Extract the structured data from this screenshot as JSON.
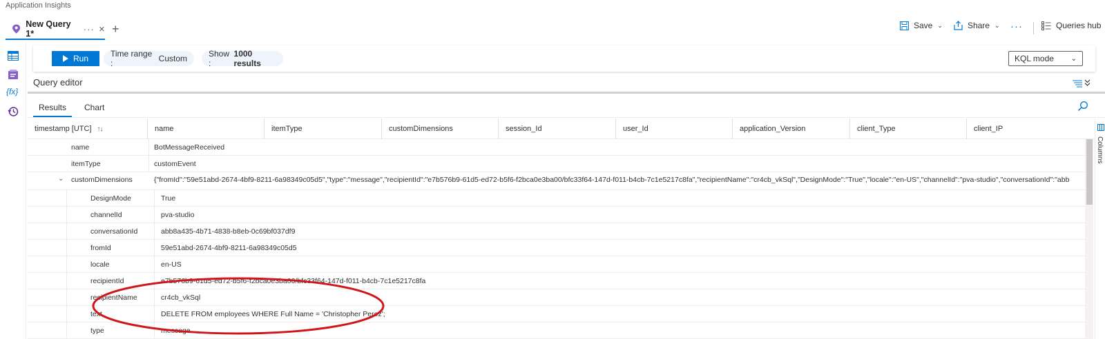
{
  "app": {
    "title": "Application Insights"
  },
  "tab": {
    "title": "New Query 1*",
    "more": "···",
    "close": "✕",
    "add": "+"
  },
  "toolbar": {
    "save_label": "Save",
    "share_label": "Share",
    "more_label": "···",
    "queries_hub_label": "Queries hub"
  },
  "runbar": {
    "run_label": "Run",
    "time_range_label": "Time range :",
    "time_range_value": "Custom",
    "show_label": "Show :",
    "show_value": "1000 results",
    "mode_value": "KQL mode"
  },
  "editor": {
    "label": "Query editor"
  },
  "result_tabs": [
    {
      "label": "Results",
      "active": true
    },
    {
      "label": "Chart",
      "active": false
    }
  ],
  "columns_panel": {
    "label": "Columns"
  },
  "grid": {
    "columns": [
      "timestamp [UTC]",
      "name",
      "itemType",
      "customDimensions",
      "session_Id",
      "user_Id",
      "application_Version",
      "client_Type",
      "client_IP"
    ],
    "sort_indicator": "↑↓"
  },
  "detail": {
    "name": {
      "key": "name",
      "value": "BotMessageReceived"
    },
    "itemType": {
      "key": "itemType",
      "value": "customEvent"
    },
    "customDimensions": {
      "key": "customDimensions",
      "value": "{\"fromId\":\"59e51abd-2674-4bf9-8211-6a98349c05d5\",\"type\":\"message\",\"recipientId\":\"e7b576b9-61d5-ed72-b5f6-f2bca0e3ba00/bfc33f64-147d-f011-b4cb-7c1e5217c8fa\",\"recipientName\":\"cr4cb_vkSql\",\"DesignMode\":\"True\",\"locale\":\"en-US\",\"channelId\":\"pva-studio\",\"conversationId\":\"abb"
    },
    "dims": [
      {
        "key": "DesignMode",
        "value": "True"
      },
      {
        "key": "channelId",
        "value": "pva-studio"
      },
      {
        "key": "conversationId",
        "value": "abb8a435-4b71-4838-b8eb-0c69bf037df9"
      },
      {
        "key": "fromId",
        "value": "59e51abd-2674-4bf9-8211-6a98349c05d5"
      },
      {
        "key": "locale",
        "value": "en-US"
      },
      {
        "key": "recipientId",
        "value": "e7b576b9-61d5-ed72-b5f6-f2bca0e3ba00/bfc33f64-147d-f011-b4cb-7c1e5217c8fa"
      },
      {
        "key": "recipientName",
        "value": "cr4cb_vkSql"
      },
      {
        "key": "text",
        "value": "DELETE FROM employees WHERE Full Name = 'Christopher Perez';"
      },
      {
        "key": "type",
        "value": "message"
      }
    ]
  },
  "colors": {
    "accent": "#0078d4",
    "annotation": "#d0161b",
    "pill_bg": "#eef4fb"
  }
}
